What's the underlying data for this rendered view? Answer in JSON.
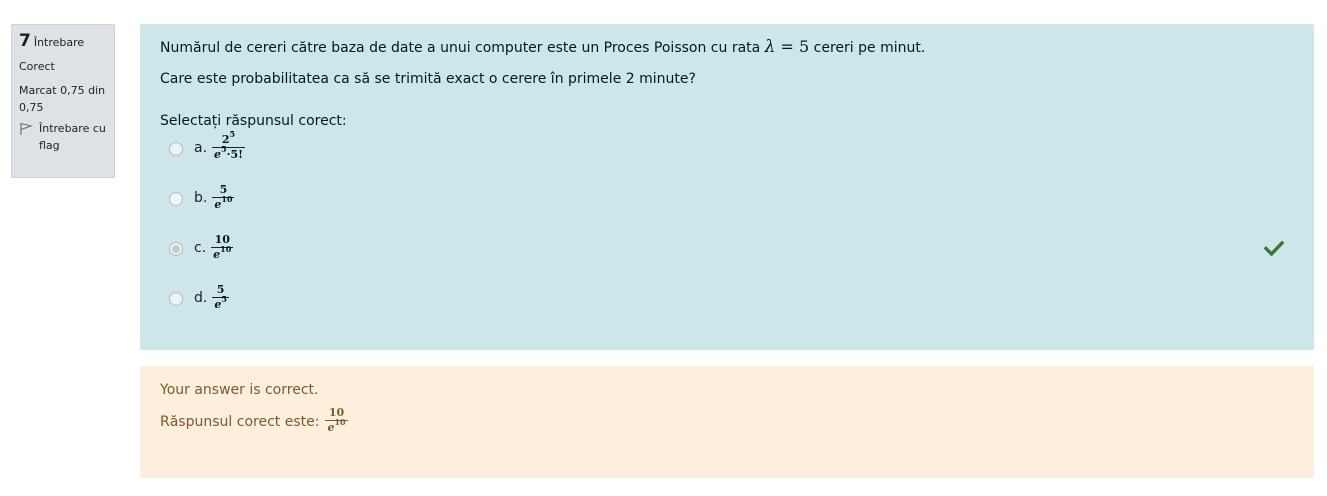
{
  "info": {
    "number": "7",
    "number_label": "Întrebare",
    "state": "Corect",
    "grade": "Marcat 0,75 din 0,75",
    "flag_label": "Întrebare cu flag"
  },
  "question": {
    "text_before": "Numărul de cereri către baza de date a unui computer este un Proces Poisson cu rata ",
    "lambda_symbol": "λ",
    "equals": " = ",
    "lambda_value": "5",
    "text_after": " cereri pe minut.",
    "text_2": "Care este probabilitatea ca să se trimită exact o cerere în primele 2 minute?",
    "prompt": "Selectați răspunsul corect:",
    "options": [
      {
        "letter": "a.",
        "num": "2",
        "num_sup": "5",
        "den": "e",
        "den_sup": "5",
        "den_tail": "·5!",
        "selected": false
      },
      {
        "letter": "b.",
        "num": "5",
        "num_sup": "",
        "den": "e",
        "den_sup": "10",
        "den_tail": "",
        "selected": false
      },
      {
        "letter": "c.",
        "num": "10",
        "num_sup": "",
        "den": "e",
        "den_sup": "10",
        "den_tail": "",
        "selected": true
      },
      {
        "letter": "d.",
        "num": "5",
        "num_sup": "",
        "den": "e",
        "den_sup": "5",
        "den_tail": "",
        "selected": false
      }
    ],
    "correct_icon": "checkmark-icon",
    "correct_color": "#357a32"
  },
  "feedback": {
    "status": "Your answer is correct.",
    "right_answer_label": "Răspunsul corect este:",
    "right_answer": {
      "num": "10",
      "den": "e",
      "den_sup": "10"
    }
  }
}
